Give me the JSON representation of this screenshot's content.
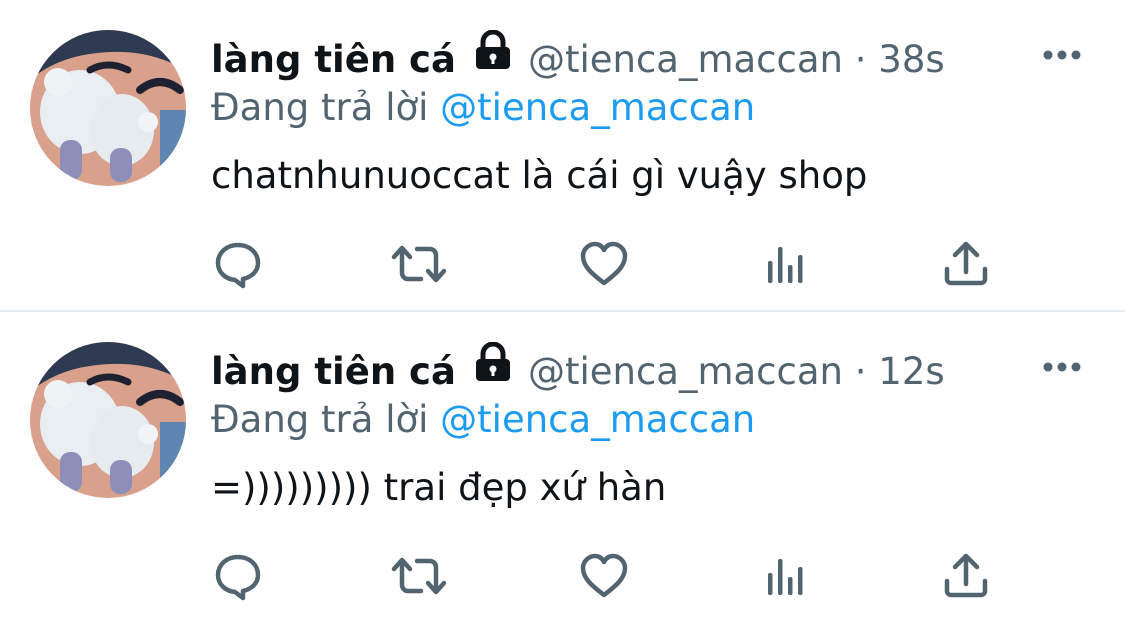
{
  "tweets": [
    {
      "display_name": "làng tiên cá",
      "handle": "@tienca_maccan",
      "separator": "·",
      "time": "38s",
      "replying_prefix": "Đang trả lời",
      "replying_to": "@tienca_maccan",
      "text": "chatnhunuoccat là cái gì vuậy shop"
    },
    {
      "display_name": "làng tiên cá",
      "handle": "@tienca_maccan",
      "separator": "·",
      "time": "12s",
      "replying_prefix": "Đang trả lời",
      "replying_to": "@tienca_maccan",
      "text": "=))))))))) trai đẹp xứ hàn"
    }
  ],
  "icons": [
    "avatar",
    "lock-icon",
    "more-icon",
    "reply-icon",
    "retweet-icon",
    "like-icon",
    "stats-icon",
    "share-icon"
  ],
  "colors": {
    "text": "#0f1419",
    "secondary": "#536471",
    "accent": "#1d9bf0",
    "divider": "#e6ecf0"
  }
}
